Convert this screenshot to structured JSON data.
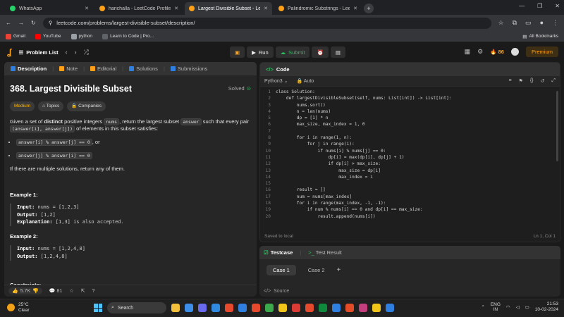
{
  "browser": {
    "tabs": [
      {
        "title": "WhatsApp",
        "favicon_color": "#25d366",
        "active": false
      },
      {
        "title": "harichalla - LeetCode Profile",
        "favicon_color": "#ffa116",
        "active": false
      },
      {
        "title": "Largest Divisible Subset - LeetC",
        "favicon_color": "#ffa116",
        "active": true
      },
      {
        "title": "Palindromic Substrings - LeetC",
        "favicon_color": "#ffa116",
        "active": false
      }
    ],
    "url": "leetcode.com/problems/largest-divisible-subset/description/",
    "bookmarks": [
      {
        "label": "Gmail",
        "color": "#ea4335"
      },
      {
        "label": "YouTube",
        "color": "#ff0000"
      },
      {
        "label": "python",
        "color": "#9aa0a6"
      },
      {
        "label": "Learn to Code | Pro...",
        "color": "#5f6368"
      }
    ],
    "all_bookmarks": "All Bookmarks"
  },
  "navbar": {
    "problem_list": "Problem List",
    "run": "Run",
    "submit": "Submit",
    "streak": "86",
    "premium": "Premium"
  },
  "left_tabs": [
    {
      "label": "Description",
      "icon": "description-icon",
      "color": "#2f7fe0",
      "active": true
    },
    {
      "label": "Note",
      "icon": "note-icon",
      "color": "#ffa116",
      "active": false
    },
    {
      "label": "Editorial",
      "icon": "editorial-icon",
      "color": "#ffa116",
      "active": false
    },
    {
      "label": "Solutions",
      "icon": "solutions-icon",
      "color": "#2f7fe0",
      "active": false
    },
    {
      "label": "Submissions",
      "icon": "submissions-icon",
      "color": "#2f7fe0",
      "active": false
    }
  ],
  "problem": {
    "title": "368. Largest Divisible Subset",
    "status": "Solved",
    "difficulty": "Medium",
    "topics": "Topics",
    "companies": "Companies",
    "desc_1": "Given a set of ",
    "desc_bold": "distinct",
    "desc_2": " positive integers ",
    "desc_nums": "nums",
    "desc_3": ", return the largest subset ",
    "desc_answer": "answer",
    "desc_4": " such that every pair ",
    "desc_pair": "(answer[i], answer[j])",
    "desc_5": " of elements in this subset satisfies:",
    "cond_1": "answer[i] % answer[j] == 0",
    "cond_1_suffix": ", or",
    "cond_2": "answer[j] % answer[i] == 0",
    "multiple": "If there are multiple solutions, return any of them.",
    "example1_title": "Example 1:",
    "example1_input": "nums = [1,2,3]",
    "example1_output": "[1,2]",
    "example1_explanation": "[1,3] is also accepted.",
    "example2_title": "Example 2:",
    "example2_input": "nums = [1,2,4,8]",
    "example2_output": "[1,2,4,8]",
    "label_input": "Input:",
    "label_output": "Output:",
    "label_explanation": "Explanation:",
    "constraints": "Constraints:"
  },
  "left_footer": {
    "likes": "5.7K",
    "comments": "81"
  },
  "code_panel": {
    "title": "Code",
    "language": "Python3",
    "autosave": "Auto",
    "status": "Saved to local",
    "cursor": "Ln 1, Col 1",
    "lines": [
      "class Solution:",
      "    def largestDivisibleSubset(self, nums: List[int]) -> List[int]:",
      "        nums.sort()",
      "        n = len(nums)",
      "        dp = [1] * n",
      "        max_size, max_index = 1, 0",
      "",
      "        for i in range(1, n):",
      "            for j in range(i):",
      "                if nums[i] % nums[j] == 0:",
      "                    dp[i] = max(dp[i], dp[j] + 1)",
      "                    if dp[i] > max_size:",
      "                        max_size = dp[i]",
      "                        max_index = i",
      "",
      "        result = []",
      "        num = nums[max_index]",
      "        for i in range(max_index, -1, -1):",
      "            if num % nums[i] == 0 and dp[i] == max_size:",
      "                result.append(nums[i])",
      "                num = nums[i]"
    ]
  },
  "testcase": {
    "tab": "Testcase",
    "result_tab": "Test Result",
    "cases": [
      "Case 1",
      "Case 2"
    ],
    "source": "Source"
  },
  "taskbar": {
    "temp": "25°C",
    "weather": "Clear",
    "search": "Search",
    "lang": "ENG",
    "region": "IN",
    "time": "21:53",
    "date": "10-02-2024",
    "apps": [
      "#f3c03b",
      "#3c8ee8",
      "#6a6aee",
      "#2f8ae0",
      "#e6492c",
      "#2f7fe0",
      "#e6492c",
      "#3aa84b",
      "#f0c419",
      "#dc3b35",
      "#e6492c",
      "#0f8a3c",
      "#2f7fe0",
      "#e34c26",
      "#c43d7d",
      "#f0c419",
      "#2f7fe0"
    ]
  }
}
